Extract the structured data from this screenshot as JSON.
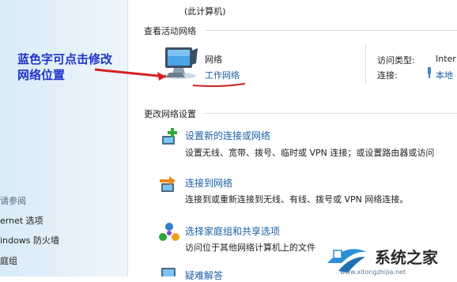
{
  "header": {
    "computer_label": "(此计算机)"
  },
  "active_networks": {
    "section_title": "查看活动网络",
    "network_name": "网络",
    "network_location_link": "工作网络",
    "access_type_label": "访问类型:",
    "access_type_value": "Inter",
    "connections_label": "连接:",
    "connections_value": "本地"
  },
  "annotation": {
    "line1": "蓝色字可点击修改",
    "line2": "网络位置",
    "color": "#1f34c7",
    "arrow_color": "#d62020"
  },
  "change_settings": {
    "section_title": "更改网络设置",
    "tasks": [
      {
        "title": "设置新的连接或网络",
        "desc": "设置无线、宽带、拨号、临时或 VPN 连接；或设置路由器或访问",
        "icon": "new-connection-icon"
      },
      {
        "title": "连接到网络",
        "desc": "连接到或重新连接到无线、有线、拨号或 VPN 网络连接。",
        "icon": "connect-network-icon"
      },
      {
        "title": "选择家庭组和共享选项",
        "desc": "访问位于其他网络计算机上的文件",
        "icon": "homegroup-icon"
      },
      {
        "title": "疑难解答",
        "icon": "troubleshoot-icon"
      }
    ]
  },
  "sidebar": {
    "see_also": "请参阅",
    "items": [
      {
        "label": "ernet 选项"
      },
      {
        "label": "indows 防火墙"
      },
      {
        "label": "庭组"
      }
    ]
  },
  "watermark": {
    "text": "系统之家",
    "url": "www.xitongzhijia.net"
  }
}
